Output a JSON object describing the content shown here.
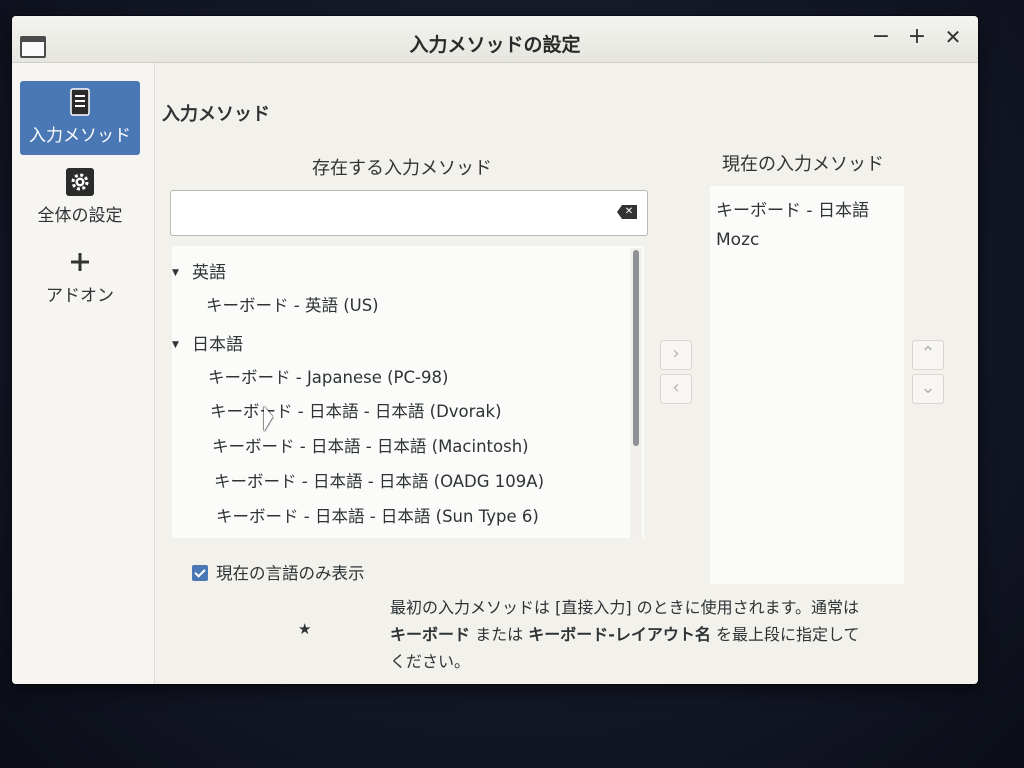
{
  "window": {
    "title": "入力メソッドの設定",
    "controls": {
      "minimize": "−",
      "maximize": "+",
      "close": "✕"
    }
  },
  "sidebar": {
    "items": [
      {
        "label": "入力メソッド",
        "icon": "document-list-icon",
        "active": true
      },
      {
        "label": "全体の設定",
        "icon": "gear-icon",
        "active": false
      },
      {
        "label": "アドオン",
        "icon": "plus-icon",
        "active": false
      }
    ]
  },
  "main": {
    "section_title": "入力メソッド",
    "available": {
      "title": "存在する入力メソッド",
      "search_value": "",
      "groups": [
        {
          "label": "英語",
          "items": [
            "キーボード - 英語 (US)"
          ]
        },
        {
          "label": "日本語",
          "items": [
            "キーボード - Japanese (PC-98)",
            "キーボード - 日本語 - 日本語 (Dvorak)",
            "キーボード - 日本語 - 日本語 (Macintosh)",
            "キーボード - 日本語 - 日本語 (OADG 109A)",
            "キーボード - 日本語 - 日本語 (Sun Type 6)"
          ]
        }
      ]
    },
    "current": {
      "title": "現在の入力メソッド",
      "items": [
        "キーボード - 日本語",
        "Mozc"
      ]
    },
    "buttons": {
      "add": "›",
      "remove": "‹",
      "up": "⌃",
      "down": "⌄"
    },
    "only_current_language": {
      "label": "現在の言語のみ表示",
      "checked": true
    },
    "note": {
      "star": "★",
      "part1": "最初の入力メソッドは [直接入力] のときに使用されます。通常は ",
      "bold1": "キーボード",
      "part2": " または ",
      "bold2": "キーボード-レイアウト名",
      "part3": " を最上段に指定してください。"
    }
  },
  "colors": {
    "accent": "#4a78b5",
    "window_bg": "#f2f1ec",
    "list_bg": "#fbfbf9"
  }
}
